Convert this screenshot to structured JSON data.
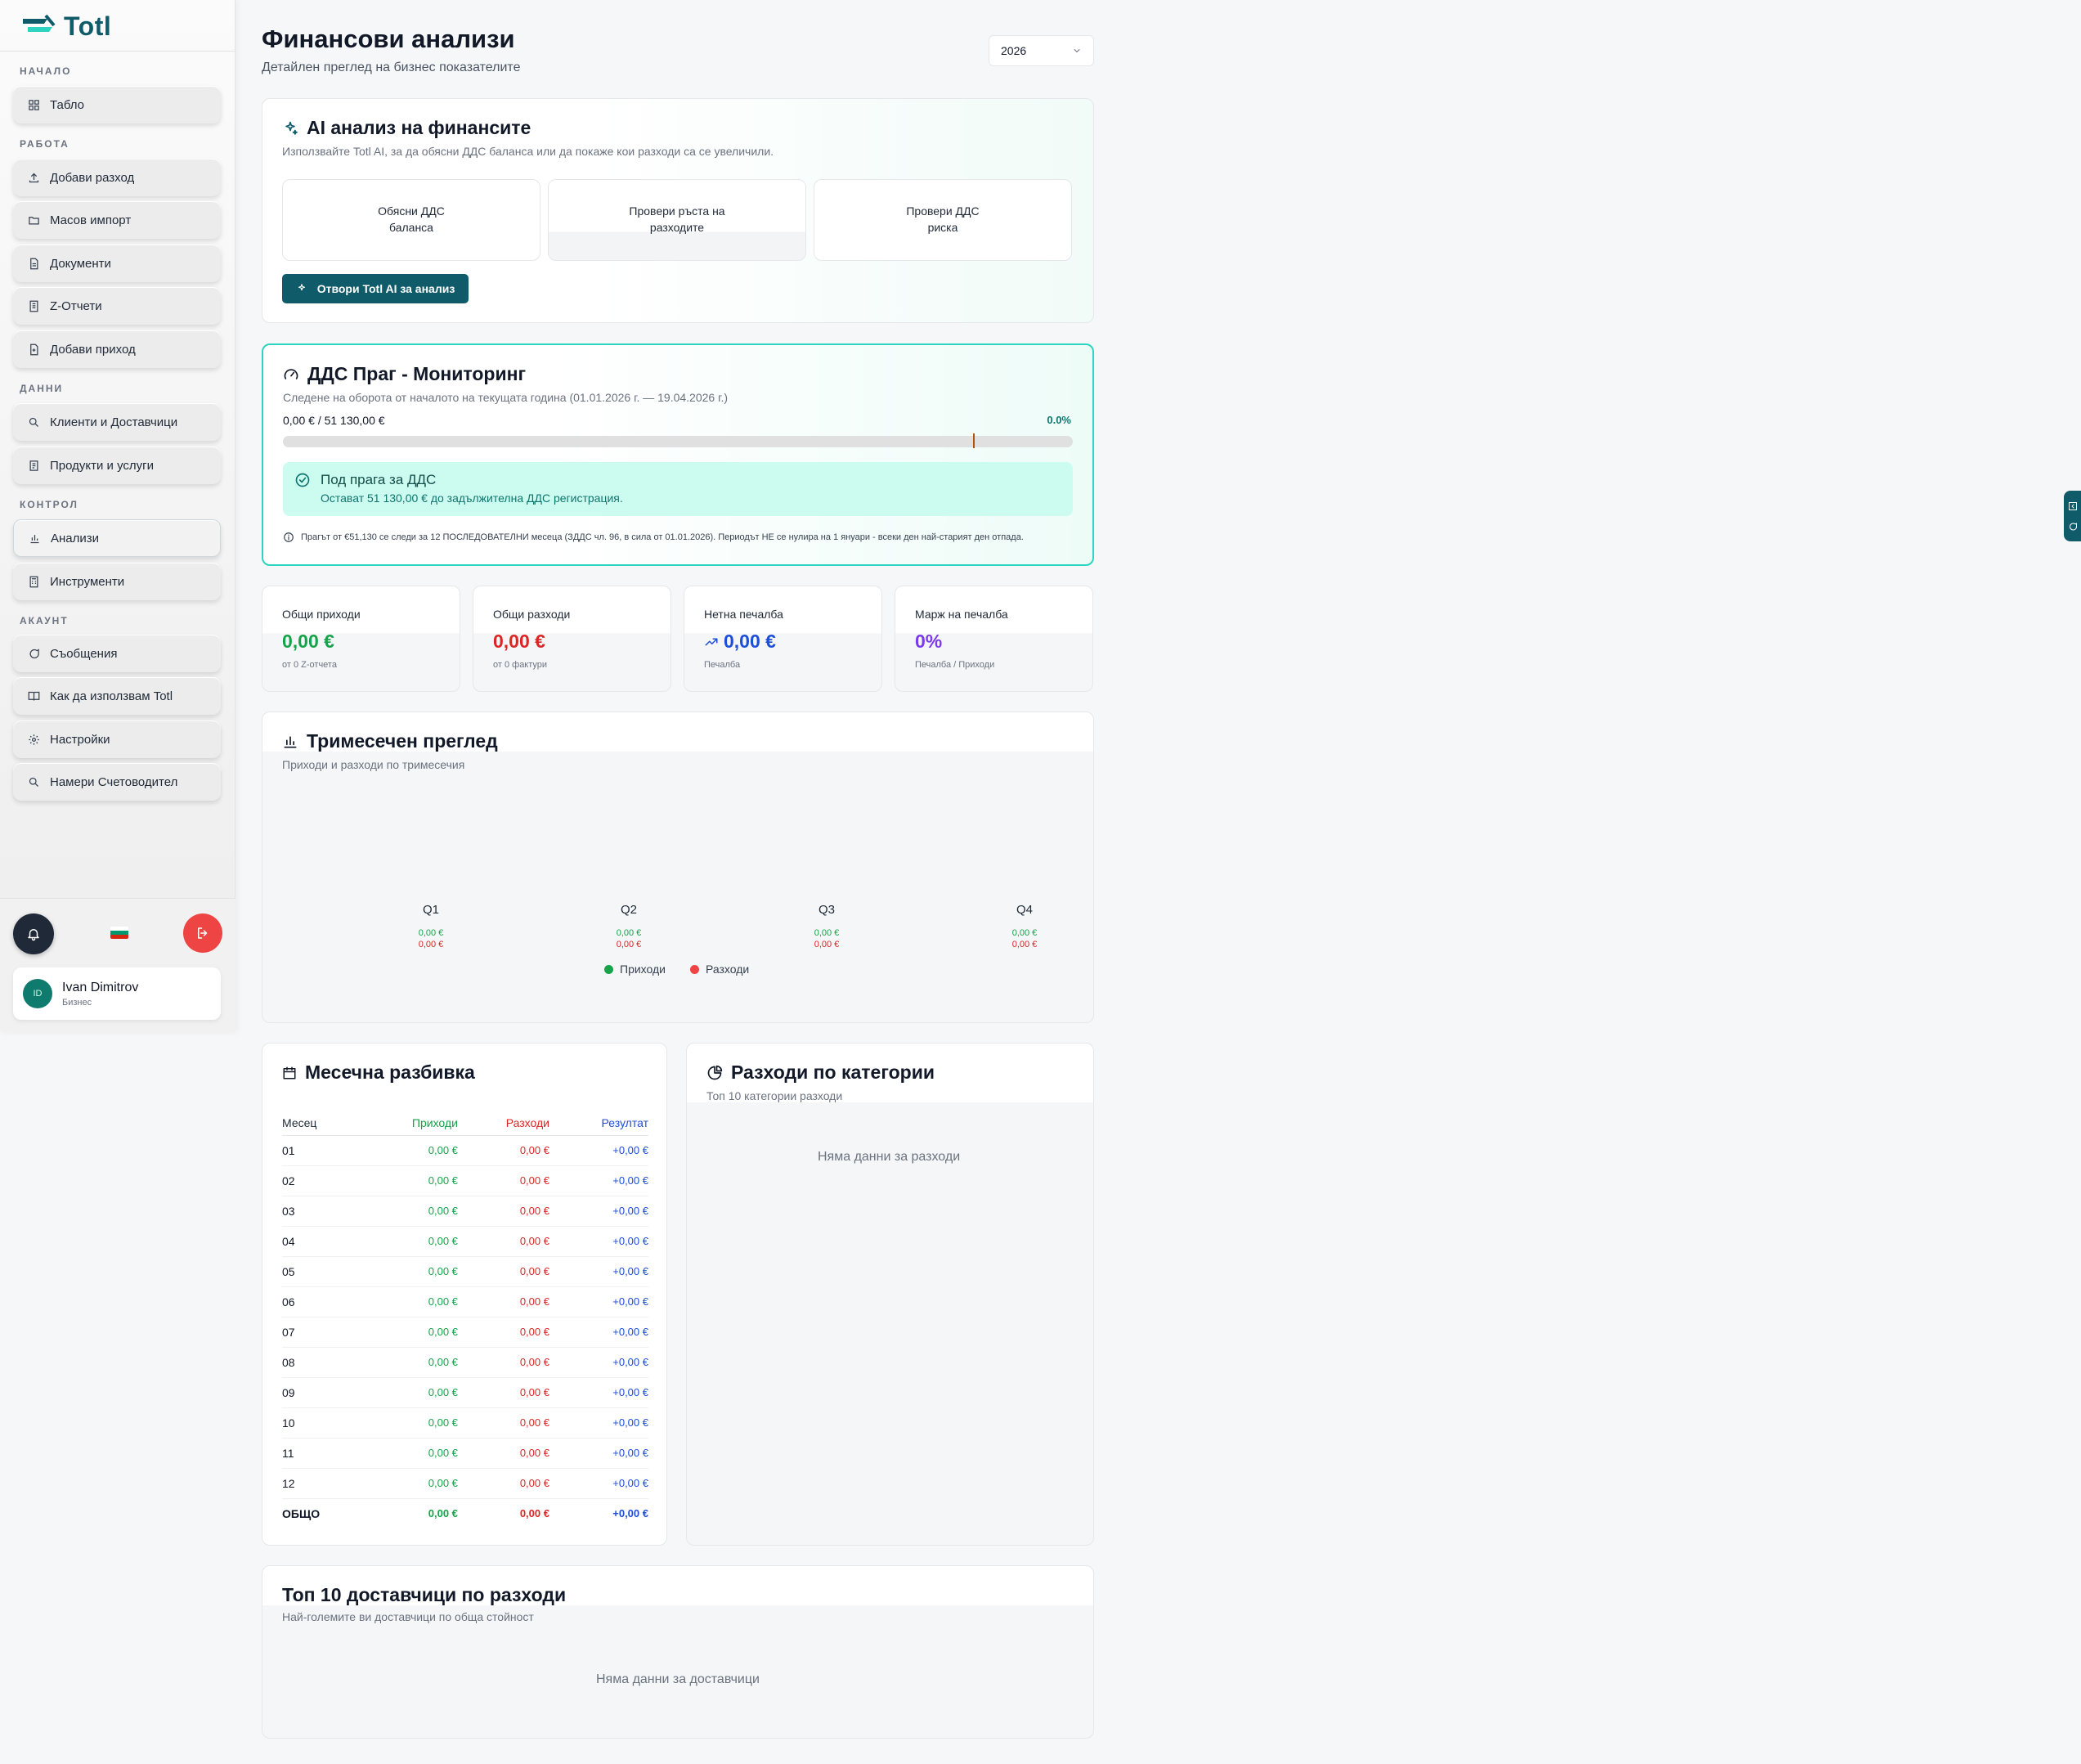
{
  "app": {
    "logo": "Totl"
  },
  "sidebar": {
    "sections": [
      {
        "label": "НАЧАЛО"
      },
      {
        "label": "РАБОТА"
      },
      {
        "label": "ДАННИ"
      },
      {
        "label": "КОНТРОЛ"
      },
      {
        "label": "АКАУНТ"
      }
    ],
    "items": [
      {
        "label": "Табло",
        "icon": "grid-icon"
      },
      {
        "label": "Добави разход",
        "icon": "upload-icon"
      },
      {
        "label": "Масов импорт",
        "icon": "folder-icon"
      },
      {
        "label": "Документи",
        "icon": "document-icon"
      },
      {
        "label": "Z-Отчети",
        "icon": "receipt-icon"
      },
      {
        "label": "Добави приход",
        "icon": "document-plus-icon"
      },
      {
        "label": "Клиенти и Доставчици",
        "icon": "search-icon"
      },
      {
        "label": "Продукти и услуги",
        "icon": "clipboard-icon"
      },
      {
        "label": "Анализи",
        "icon": "bar-chart-icon",
        "active": true
      },
      {
        "label": "Инструменти",
        "icon": "calculator-icon"
      },
      {
        "label": "Съобщения",
        "icon": "chat-icon"
      },
      {
        "label": "Как да използвам Totl",
        "icon": "book-icon"
      },
      {
        "label": "Настройки",
        "icon": "gear-icon"
      },
      {
        "label": "Намери Счетоводител",
        "icon": "search-icon"
      }
    ],
    "user": {
      "initials": "ID",
      "name": "Ivan Dimitrov",
      "role": "Бизнес"
    }
  },
  "header": {
    "title": "Финансови анализи",
    "subtitle": "Детайлен преглед на бизнес показателите",
    "year": "2026"
  },
  "ai": {
    "title": "AI анализ на финансите",
    "subtitle": "Използвайте Totl AI, за да обясни ДДС баланса или да покаже кои разходи са се увеличили.",
    "buttons": [
      "Обясни ДДС\nбаланса",
      "Провери ръста на\nразходите",
      "Провери ДДС\nриска"
    ],
    "open_label": "Отвори Totl AI за анализ"
  },
  "vat": {
    "title": "ДДС Праг - Мониторинг",
    "subtitle": "Следене на оборота от началото на текущата година (01.01.2026 г. — 19.04.2026 г.)",
    "amount": "0,00 € / 51 130,00 €",
    "percent_label": "0.0%",
    "progress": 0.0,
    "status_title": "Под прага за ДДС",
    "status_sub": "Остават 51 130,00 € до задължителна ДДС регистрация.",
    "note": "Прагът от €51,130 се следи за 12 ПОСЛЕДОВАТЕЛНИ месеца (ЗДДС чл. 96, в сила от 01.01.2026). Периодът НЕ се нулира на 1 януари - всеки ден най-старият ден отпада."
  },
  "stats": [
    {
      "label": "Общи приходи",
      "value": "0,00 €",
      "sub": "от 0 Z-отчета",
      "color": "#16a34a"
    },
    {
      "label": "Общи разходи",
      "value": "0,00 €",
      "sub": "от 0 фактури",
      "color": "#dc2626"
    },
    {
      "label": "Нетна печалба",
      "value": "0,00 €",
      "sub": "Печалба",
      "color": "#1d4ed8"
    },
    {
      "label": "Марж на печалба",
      "value": "0%",
      "sub": "Печалба / Приходи",
      "color": "#7c3aed"
    }
  ],
  "quarterly": {
    "title": "Тримесечен преглед",
    "subtitle": "Приходи и разходи по тримесечия",
    "quarters": [
      {
        "label": "Q1",
        "income": "0,00 €",
        "expense": "0,00 €"
      },
      {
        "label": "Q2",
        "income": "0,00 €",
        "expense": "0,00 €"
      },
      {
        "label": "Q3",
        "income": "0,00 €",
        "expense": "0,00 €"
      },
      {
        "label": "Q4",
        "income": "0,00 €",
        "expense": "0,00 €"
      }
    ],
    "legend": {
      "income": "Приходи",
      "expense": "Разходи"
    },
    "colors": {
      "income": "#16a34a",
      "expense": "#ef4444"
    }
  },
  "monthly": {
    "title": "Месечна разбивка",
    "headers": [
      "Месец",
      "Приходи",
      "Разходи",
      "Резултат"
    ],
    "rows": [
      [
        "01",
        "0,00 €",
        "0,00 €",
        "+0,00 €"
      ],
      [
        "02",
        "0,00 €",
        "0,00 €",
        "+0,00 €"
      ],
      [
        "03",
        "0,00 €",
        "0,00 €",
        "+0,00 €"
      ],
      [
        "04",
        "0,00 €",
        "0,00 €",
        "+0,00 €"
      ],
      [
        "05",
        "0,00 €",
        "0,00 €",
        "+0,00 €"
      ],
      [
        "06",
        "0,00 €",
        "0,00 €",
        "+0,00 €"
      ],
      [
        "07",
        "0,00 €",
        "0,00 €",
        "+0,00 €"
      ],
      [
        "08",
        "0,00 €",
        "0,00 €",
        "+0,00 €"
      ],
      [
        "09",
        "0,00 €",
        "0,00 €",
        "+0,00 €"
      ],
      [
        "10",
        "0,00 €",
        "0,00 €",
        "+0,00 €"
      ],
      [
        "11",
        "0,00 €",
        "0,00 €",
        "+0,00 €"
      ],
      [
        "12",
        "0,00 €",
        "0,00 €",
        "+0,00 €"
      ]
    ],
    "total": [
      "ОБЩО",
      "0,00 €",
      "0,00 €",
      "+0,00 €"
    ]
  },
  "categories": {
    "title": "Разходи по категории",
    "subtitle": "Топ 10 категории разходи",
    "empty": "Няма данни за разходи"
  },
  "suppliers": {
    "title": "Топ 10 доставчици по разходи",
    "subtitle": "Най-големите ви доставчици по обща стойност",
    "empty": "Няма данни за доставчици"
  }
}
